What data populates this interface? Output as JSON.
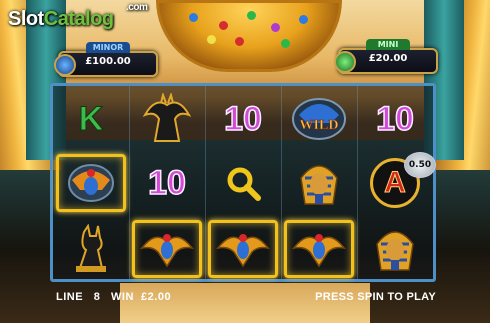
{
  "logo": {
    "part1": "Slot",
    "part2": "Catalog",
    "part3": ".com"
  },
  "jackpots": {
    "minor": {
      "label": "MINOR",
      "value": "£100.00"
    },
    "mini": {
      "label": "MINI",
      "value": "£20.00"
    }
  },
  "reels": [
    [
      "10-text:K",
      "anubis-jackal-icon",
      "scarab-amulet-icon"
    ],
    [
      "jackal-statue-icon",
      "10-text:10",
      "scarab-amulet-icon"
    ],
    [
      "10-text:10",
      "magnifier-icon",
      "scarab-amulet-icon"
    ],
    [
      "wild-icon",
      "pharaoh-mask-icon",
      "scarab-amulet-icon"
    ],
    [
      "10-text:10",
      "ring-A",
      "pharaoh-mask-icon"
    ]
  ],
  "symbols": {
    "r1c1": "K",
    "r1c3": "10",
    "r1c5": "10",
    "r2c2": "10",
    "r2c5": "A",
    "wild": "WILD"
  },
  "bet_badge": "0.50",
  "footer": {
    "line_label": "LINE",
    "line_value": "8",
    "win_label": "WIN",
    "win_value": "£2.00",
    "status": "PRESS SPIN TO PLAY"
  },
  "colors": {
    "reel_border": "#4f8fc8",
    "win_highlight": "#f3c11c",
    "ten_symbol": "#d24bd6"
  }
}
